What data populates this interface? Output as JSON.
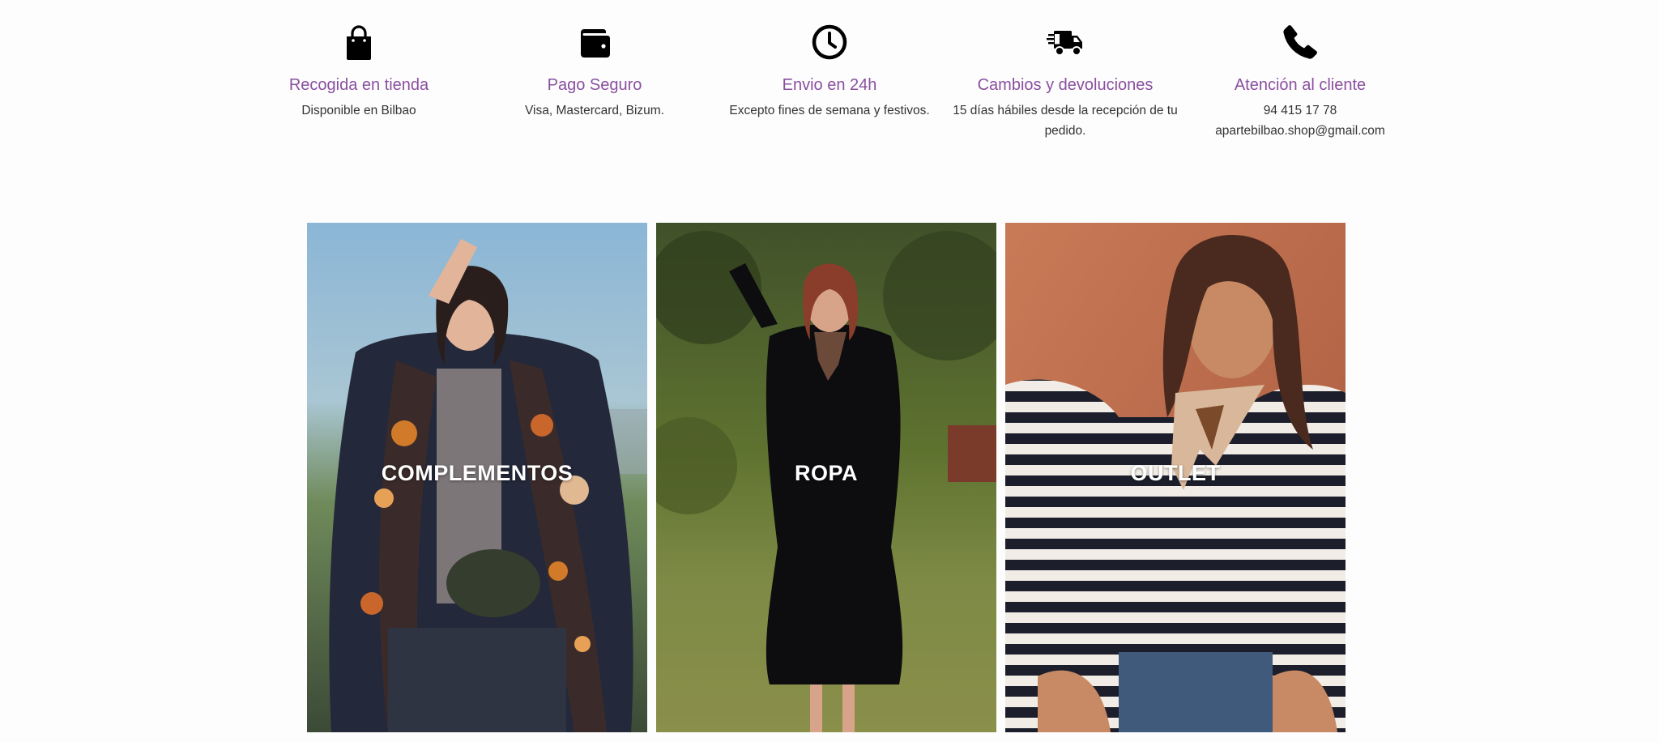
{
  "features": [
    {
      "icon": "shopping-bag-icon",
      "title": "Recogida en tienda",
      "lines": [
        "Disponible en Bilbao"
      ]
    },
    {
      "icon": "wallet-icon",
      "title": "Pago Seguro",
      "lines": [
        "Visa, Mastercard, Bizum."
      ]
    },
    {
      "icon": "clock-icon",
      "title": "Envio en 24h",
      "lines": [
        "Excepto fines de semana y festivos."
      ]
    },
    {
      "icon": "delivery-truck-icon",
      "title": "Cambios y devoluciones",
      "lines": [
        "15 días hábiles desde la recepción de tu",
        "pedido."
      ]
    },
    {
      "icon": "phone-icon",
      "title": "Atención al cliente",
      "lines": [
        "94 415 17 78",
        "apartebilbao.shop@gmail.com"
      ]
    }
  ],
  "categories": [
    {
      "label": "COMPLEMENTOS",
      "image": "woman-with-patterned-scarf-photo"
    },
    {
      "label": "ROPA",
      "image": "woman-in-black-dress-garden-photo"
    },
    {
      "label": "OUTLET",
      "image": "woman-in-striped-shirt-photo"
    }
  ],
  "colors": {
    "accent": "#8a4f9e",
    "text": "#333333",
    "background": "#fdfdfe"
  }
}
